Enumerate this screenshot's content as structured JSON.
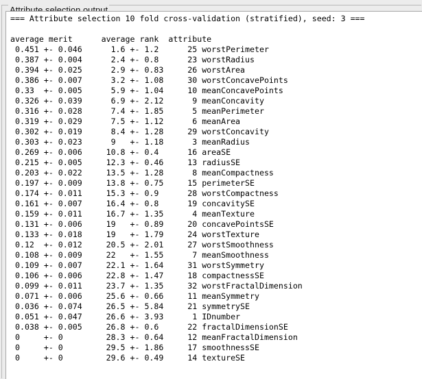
{
  "panel": {
    "title": "Attribute selection output"
  },
  "output": {
    "header_line": "=== Attribute selection 10 fold cross-validation (stratified), seed: 3 ===",
    "blank_line": "",
    "column_header": "average merit      average rank  attribute",
    "rows": [
      " 0.451 +- 0.046      1.6 +- 1.2      25 worstPerimeter",
      " 0.387 +- 0.004      2.4 +- 0.8      23 worstRadius",
      " 0.394 +- 0.025      2.9 +- 0.83     26 worstArea",
      " 0.386 +- 0.007      3.2 +- 1.08     30 worstConcavePoints",
      " 0.33  +- 0.005      5.9 +- 1.04     10 meanConcavePoints",
      " 0.326 +- 0.039      6.9 +- 2.12      9 meanConcavity",
      " 0.316 +- 0.028      7.4 +- 1.85      5 meanPerimeter",
      " 0.319 +- 0.029      7.5 +- 1.12      6 meanArea",
      " 0.302 +- 0.019      8.4 +- 1.28     29 worstConcavity",
      " 0.303 +- 0.023      9   +- 1.18      3 meanRadius",
      " 0.269 +- 0.006     10.8 +- 0.4      16 areaSE",
      " 0.215 +- 0.005     12.3 +- 0.46     13 radiusSE",
      " 0.203 +- 0.022     13.5 +- 1.28      8 meanCompactness",
      " 0.197 +- 0.009     13.8 +- 0.75     15 perimeterSE",
      " 0.174 +- 0.011     15.3 +- 0.9      28 worstCompactness",
      " 0.161 +- 0.007     16.4 +- 0.8      19 concavitySE",
      " 0.159 +- 0.011     16.7 +- 1.35      4 meanTexture",
      " 0.131 +- 0.006     19   +- 0.89     20 concavePointsSE",
      " 0.133 +- 0.018     19   +- 1.79     24 worstTexture",
      " 0.12  +- 0.012     20.5 +- 2.01     27 worstSmoothness",
      " 0.108 +- 0.009     22   +- 1.55      7 meanSmoothness",
      " 0.109 +- 0.007     22.1 +- 1.64     31 worstSymmetry",
      " 0.106 +- 0.006     22.8 +- 1.47     18 compactnessSE",
      " 0.099 +- 0.011     23.7 +- 1.35     32 worstFractalDimension",
      " 0.071 +- 0.006     25.6 +- 0.66     11 meanSymmetry",
      " 0.036 +- 0.074     26.5 +- 5.84     21 symmetrySE",
      " 0.051 +- 0.047     26.6 +- 3.93      1 IDnumber",
      " 0.038 +- 0.005     26.8 +- 0.6      22 fractalDimensionSE",
      " 0     +- 0         28.3 +- 0.64     12 meanFractalDimension",
      " 0     +- 0         29.5 +- 1.86     17 smoothnessSE",
      " 0     +- 0         29.6 +- 0.49     14 textureSE"
    ]
  }
}
